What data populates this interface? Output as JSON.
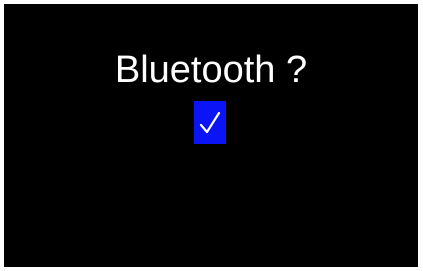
{
  "screen": {
    "prompt_text": "Bluetooth ?",
    "checkbox": {
      "checked": true,
      "icon": "checkmark-icon",
      "fill_color": "#0a14f5",
      "mark_color": "#ffffff"
    },
    "background_color": "#000000",
    "border_color": "#ffffff"
  }
}
